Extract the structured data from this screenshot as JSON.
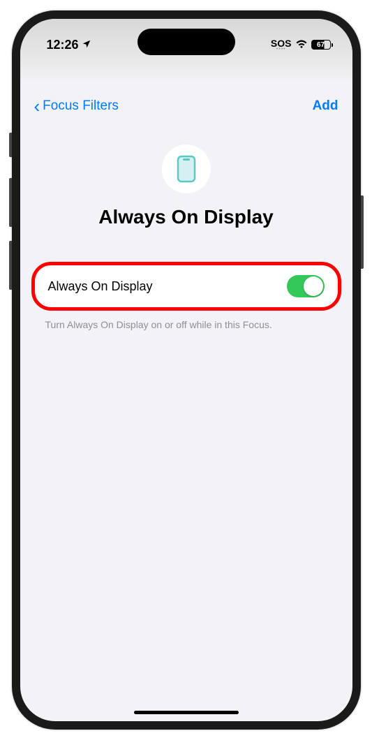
{
  "status_bar": {
    "time": "12:26",
    "sos": "SOS",
    "battery_level": "67"
  },
  "nav": {
    "back_label": "Focus Filters",
    "add_label": "Add"
  },
  "page": {
    "title": "Always On Display"
  },
  "setting": {
    "label": "Always On Display",
    "enabled": true,
    "footer": "Turn Always On Display on or off while in this Focus."
  }
}
